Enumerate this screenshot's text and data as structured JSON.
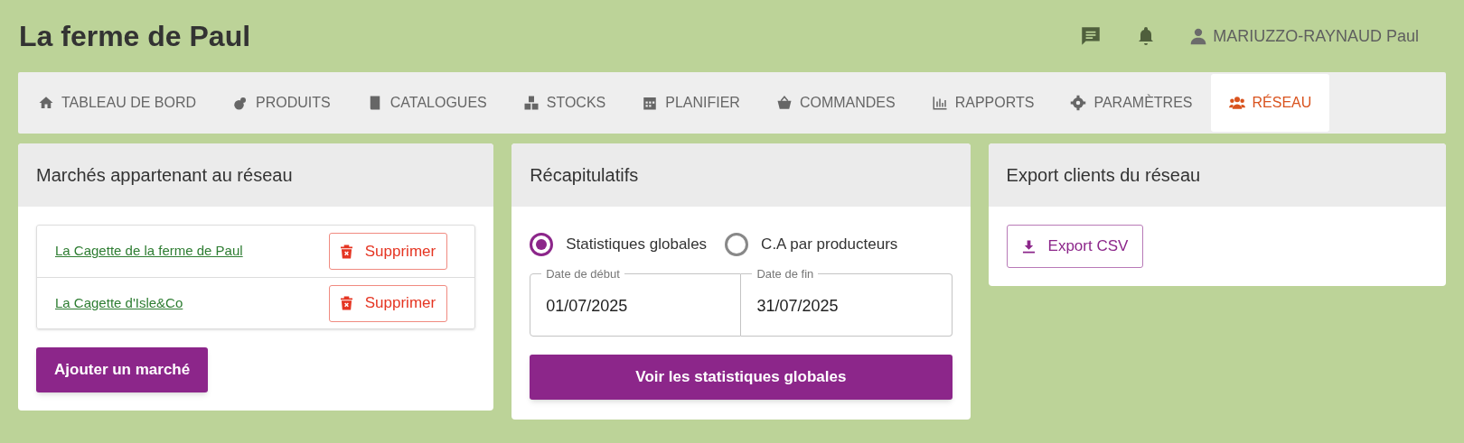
{
  "header": {
    "title": "La ferme de Paul",
    "user": "MARIUZZO-RAYNAUD Paul"
  },
  "tabs": [
    {
      "label": "TABLEAU DE BORD",
      "selected": false
    },
    {
      "label": "PRODUITS",
      "selected": false
    },
    {
      "label": "CATALOGUES",
      "selected": false
    },
    {
      "label": "STOCKS",
      "selected": false
    },
    {
      "label": "PLANIFIER",
      "selected": false
    },
    {
      "label": "COMMANDES",
      "selected": false
    },
    {
      "label": "RAPPORTS",
      "selected": false
    },
    {
      "label": "PARAMÈTRES",
      "selected": false
    },
    {
      "label": "RÉSEAU",
      "selected": true
    }
  ],
  "markets_card": {
    "title": "Marchés appartenant au réseau",
    "markets": [
      {
        "name": "La Cagette de la ferme de Paul",
        "action": "Supprimer"
      },
      {
        "name": "La Cagette d'Isle&Co",
        "action": "Supprimer"
      }
    ],
    "add_button": "Ajouter un marché"
  },
  "summary_card": {
    "title": "Récapitulatifs",
    "options": [
      {
        "label": "Statistiques globales",
        "selected": true
      },
      {
        "label": "C.A par producteurs",
        "selected": false
      }
    ],
    "start_date": {
      "label": "Date de début",
      "value": "01/07/2025"
    },
    "end_date": {
      "label": "Date de fin",
      "value": "31/07/2025"
    },
    "button": "Voir les statistiques globales"
  },
  "export_card": {
    "title": "Export clients du réseau",
    "button": "Export CSV"
  }
}
